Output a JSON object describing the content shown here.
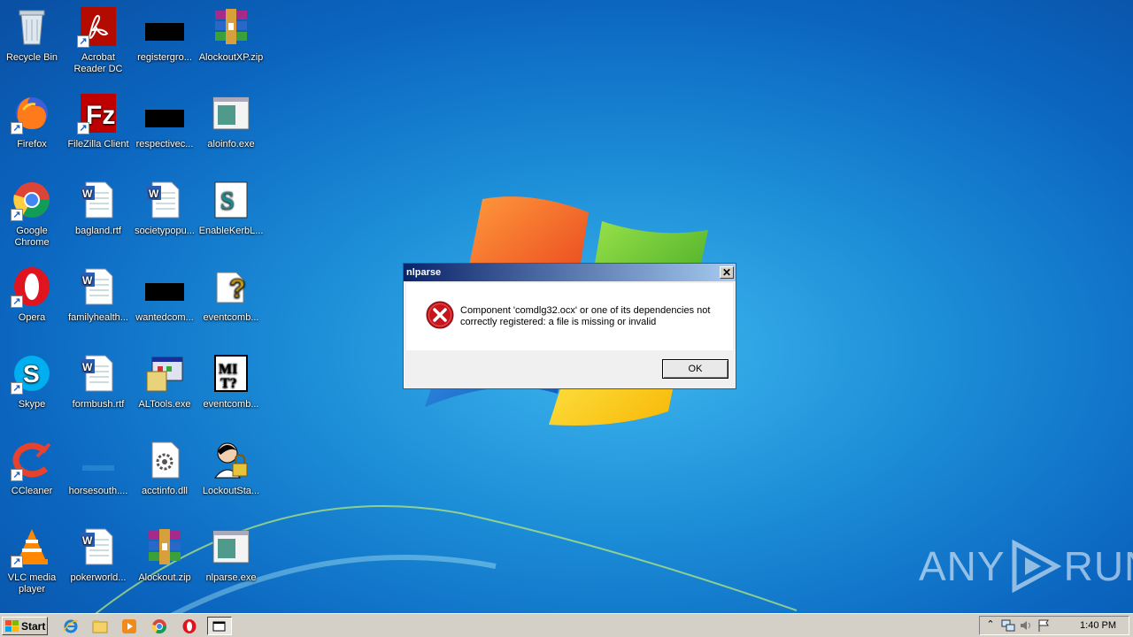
{
  "desktop": {
    "icons": [
      {
        "label": "Recycle Bin",
        "icon": "recycle-bin-icon"
      },
      {
        "label": "Acrobat Reader DC",
        "icon": "acrobat-icon"
      },
      {
        "label": "registergro...",
        "icon": "black-file-icon"
      },
      {
        "label": "AlockoutXP.zip",
        "icon": "winrar-icon"
      },
      {
        "label": "Firefox",
        "icon": "firefox-icon"
      },
      {
        "label": "FileZilla Client",
        "icon": "filezilla-icon"
      },
      {
        "label": "respectivec...",
        "icon": "black-file-icon"
      },
      {
        "label": "aloinfo.exe",
        "icon": "exe-window-icon"
      },
      {
        "label": "Google Chrome",
        "icon": "chrome-icon"
      },
      {
        "label": "bagland.rtf",
        "icon": "word-doc-icon"
      },
      {
        "label": "societypopu...",
        "icon": "word-doc-icon"
      },
      {
        "label": "EnableKerbL...",
        "icon": "script-icon"
      },
      {
        "label": "Opera",
        "icon": "opera-icon"
      },
      {
        "label": "familyhealth...",
        "icon": "word-doc-icon"
      },
      {
        "label": "wantedcom...",
        "icon": "black-file-icon"
      },
      {
        "label": "eventcomb...",
        "icon": "help-file-icon"
      },
      {
        "label": "Skype",
        "icon": "skype-icon"
      },
      {
        "label": "formbush.rtf",
        "icon": "word-doc-icon"
      },
      {
        "label": "ALTools.exe",
        "icon": "installer-icon"
      },
      {
        "label": "eventcomb...",
        "icon": "eventcomb-icon"
      },
      {
        "label": "CCleaner",
        "icon": "ccleaner-icon"
      },
      {
        "label": "horsesouth....",
        "icon": "blank-file-icon"
      },
      {
        "label": "acctinfo.dll",
        "icon": "dll-icon"
      },
      {
        "label": "LockoutSta...",
        "icon": "lockout-icon"
      },
      {
        "label": "VLC media player",
        "icon": "vlc-icon"
      },
      {
        "label": "pokerworld...",
        "icon": "word-doc-icon"
      },
      {
        "label": "Alockout.zip",
        "icon": "winrar-icon"
      },
      {
        "label": "nlparse.exe",
        "icon": "exe-window-icon"
      }
    ]
  },
  "dialog": {
    "title": "nlparse",
    "close_label": "✕",
    "message_line1": "Component 'comdlg32.ocx' or one of its dependencies not",
    "message_line2": "correctly registered: a file is missing or invalid",
    "ok_label": "OK",
    "icon": "error-icon"
  },
  "taskbar": {
    "start_label": "Start",
    "pinned": [
      "internet-explorer-icon",
      "explorer-icon",
      "media-player-icon",
      "chrome-icon",
      "opera-icon",
      "nlparse-window-icon"
    ],
    "clock": "1:40 PM"
  },
  "watermark": {
    "left": "ANY",
    "right": "RUN"
  },
  "colors": {
    "desktop_bg": "#1d8fd8",
    "taskbar_bg": "#d4d0c8",
    "titlebar_start": "#0a246a",
    "titlebar_end": "#a6caf0",
    "error_red": "#c4161c"
  }
}
